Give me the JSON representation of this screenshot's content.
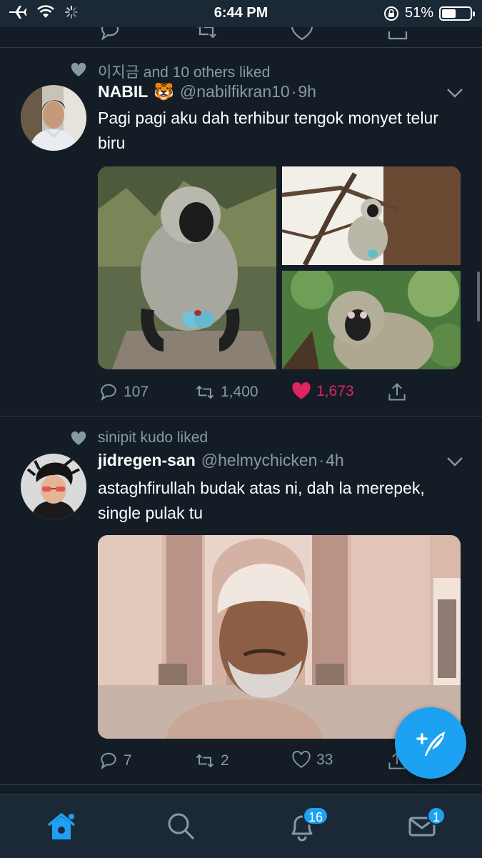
{
  "status_bar": {
    "time": "6:44 PM",
    "battery_percent": "51%",
    "battery_level": 0.51
  },
  "tweets": [
    {
      "social_context": "이지금 and 10 others liked",
      "display_name": "NABIL",
      "emoji": "🐯",
      "handle": "@nabilfikran10",
      "dot": "·",
      "time": "9h",
      "text": "Pagi pagi aku dah terhibur tengok monyet telur biru",
      "replies": "107",
      "retweets": "1,400",
      "likes": "1,673",
      "liked": true
    },
    {
      "social_context": "sinipit kudo liked",
      "display_name": "jidregen-san",
      "handle": "@helmychicken",
      "dot": "·",
      "time": "4h",
      "text": "astaghfirullah budak atas ni, dah la merepek, single pulak tu",
      "replies": "7",
      "retweets": "2",
      "likes": "33",
      "liked": false
    }
  ],
  "tab_bar": {
    "notifications_badge": "16",
    "messages_badge": "1"
  },
  "colors": {
    "background": "#141d26",
    "accent": "#1da1f2",
    "like": "#e0245e",
    "muted": "#8899a6"
  }
}
